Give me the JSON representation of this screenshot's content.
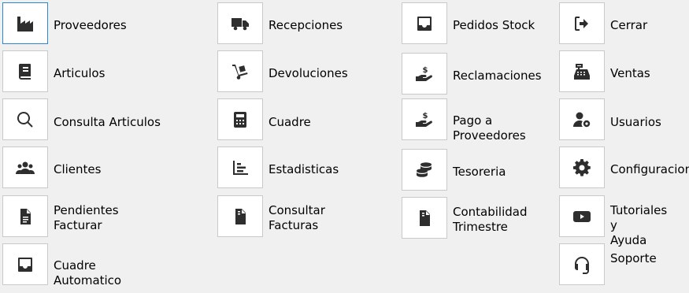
{
  "menu": {
    "col1": [
      {
        "label": "Proveedores",
        "icon": "factory-icon"
      },
      {
        "label": "Articulos",
        "icon": "book-icon"
      },
      {
        "label": "Consulta Articulos",
        "icon": "search-icon"
      },
      {
        "label": "Clientes",
        "icon": "users-icon"
      },
      {
        "label": "Pendientes\nFacturar",
        "icon": "document-icon"
      },
      {
        "label": "Cuadre\nAutomatico",
        "icon": "inbox-icon"
      }
    ],
    "col2": [
      {
        "label": "Recepciones",
        "icon": "truck-icon"
      },
      {
        "label": "Devoluciones",
        "icon": "dolly-icon"
      },
      {
        "label": "Cuadre",
        "icon": "calculator-icon"
      },
      {
        "label": "Estadisticas",
        "icon": "bar-chart-icon"
      },
      {
        "label": "Consultar\nFacturas",
        "icon": "invoice-icon"
      }
    ],
    "col3": [
      {
        "label": "Pedidos Stock",
        "icon": "inbox-icon"
      },
      {
        "label": "Reclamaciones",
        "icon": "hand-dollar-icon"
      },
      {
        "label": "Pago a\nProveedores",
        "icon": "hand-dollar-icon"
      },
      {
        "label": "Tesoreria",
        "icon": "coins-icon"
      },
      {
        "label": "Contabilidad\nTrimestre",
        "icon": "invoice-icon"
      }
    ],
    "col4": [
      {
        "label": "Cerrar",
        "icon": "logout-icon"
      },
      {
        "label": "Ventas",
        "icon": "cash-register-icon"
      },
      {
        "label": "Usuarios",
        "icon": "user-gear-icon"
      },
      {
        "label": "Configuracion",
        "icon": "gear-icon"
      },
      {
        "label": "Tutoriales y\nAyuda",
        "icon": "youtube-icon"
      },
      {
        "label": "Soporte",
        "icon": "headset-icon"
      }
    ]
  },
  "colors": {
    "background": "#f0f0f0",
    "button": "#ffffff",
    "icon": "#2e2e2e",
    "selected_border": "#2b86d6"
  }
}
